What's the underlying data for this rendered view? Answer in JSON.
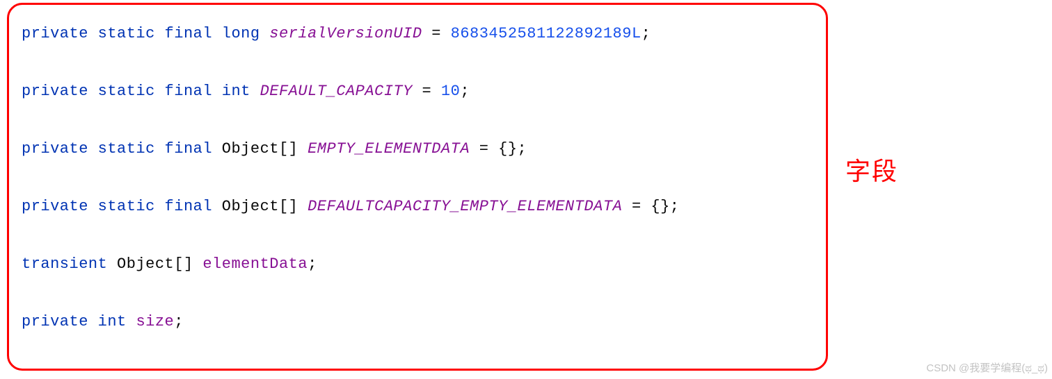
{
  "annotation": "字段",
  "watermark": "CSDN @我要学编程(ಥ_ಥ)",
  "lines": [
    {
      "tokens": [
        {
          "t": "private",
          "c": "kw"
        },
        {
          "t": " ",
          "c": "plain"
        },
        {
          "t": "static",
          "c": "kw"
        },
        {
          "t": " ",
          "c": "plain"
        },
        {
          "t": "final",
          "c": "kw"
        },
        {
          "t": " ",
          "c": "plain"
        },
        {
          "t": "long",
          "c": "kw"
        },
        {
          "t": " ",
          "c": "plain"
        },
        {
          "t": "serialVersionUID",
          "c": "field-italic"
        },
        {
          "t": " = ",
          "c": "plain"
        },
        {
          "t": "8683452581122892189L",
          "c": "num"
        },
        {
          "t": ";",
          "c": "plain"
        }
      ]
    },
    {
      "tokens": [
        {
          "t": "private",
          "c": "kw"
        },
        {
          "t": " ",
          "c": "plain"
        },
        {
          "t": "static",
          "c": "kw"
        },
        {
          "t": " ",
          "c": "plain"
        },
        {
          "t": "final",
          "c": "kw"
        },
        {
          "t": " ",
          "c": "plain"
        },
        {
          "t": "int",
          "c": "kw"
        },
        {
          "t": " ",
          "c": "plain"
        },
        {
          "t": "DEFAULT_CAPACITY",
          "c": "field-italic"
        },
        {
          "t": " = ",
          "c": "plain"
        },
        {
          "t": "10",
          "c": "num"
        },
        {
          "t": ";",
          "c": "plain"
        }
      ]
    },
    {
      "tokens": [
        {
          "t": "private",
          "c": "kw"
        },
        {
          "t": " ",
          "c": "plain"
        },
        {
          "t": "static",
          "c": "kw"
        },
        {
          "t": " ",
          "c": "plain"
        },
        {
          "t": "final",
          "c": "kw"
        },
        {
          "t": " Object[] ",
          "c": "plain"
        },
        {
          "t": "EMPTY_ELEMENTDATA",
          "c": "field-italic"
        },
        {
          "t": " = {};",
          "c": "plain"
        }
      ]
    },
    {
      "tokens": [
        {
          "t": "private",
          "c": "kw"
        },
        {
          "t": " ",
          "c": "plain"
        },
        {
          "t": "static",
          "c": "kw"
        },
        {
          "t": " ",
          "c": "plain"
        },
        {
          "t": "final",
          "c": "kw"
        },
        {
          "t": " Object[] ",
          "c": "plain"
        },
        {
          "t": "DEFAULTCAPACITY_EMPTY_ELEMENTDATA",
          "c": "field-italic"
        },
        {
          "t": " = {};",
          "c": "plain"
        }
      ]
    },
    {
      "tokens": [
        {
          "t": "transient",
          "c": "kw"
        },
        {
          "t": " Object[] ",
          "c": "plain"
        },
        {
          "t": "elementData",
          "c": "field"
        },
        {
          "t": ";",
          "c": "plain"
        }
      ]
    },
    {
      "tokens": [
        {
          "t": "private",
          "c": "kw"
        },
        {
          "t": " ",
          "c": "plain"
        },
        {
          "t": "int",
          "c": "kw"
        },
        {
          "t": " ",
          "c": "plain"
        },
        {
          "t": "size",
          "c": "field"
        },
        {
          "t": ";",
          "c": "plain"
        }
      ]
    }
  ]
}
